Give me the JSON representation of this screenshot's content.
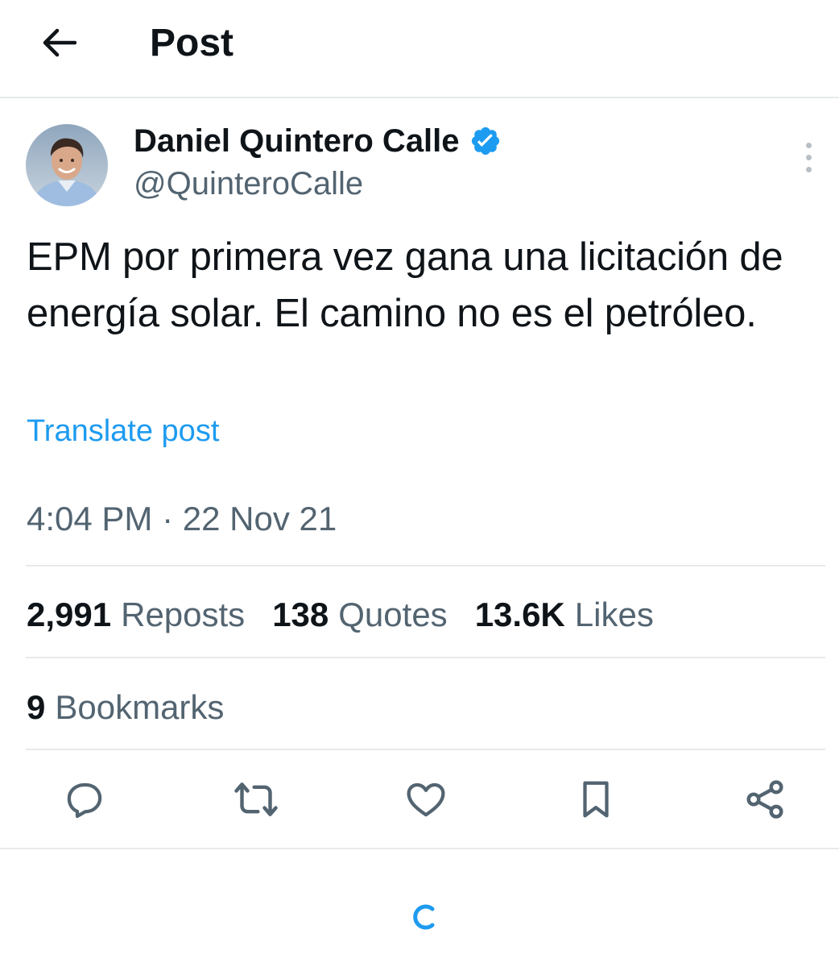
{
  "header": {
    "title": "Post",
    "back_icon": "arrow-left-icon"
  },
  "author": {
    "name": "Daniel Quintero Calle",
    "handle": "@QuinteroCalle",
    "verified": true,
    "verified_color": "#1d9bf0"
  },
  "post": {
    "text": "EPM por primera vez gana una licitación de energía solar. El camino no es el petróleo.",
    "translate_label": "Translate post",
    "timestamp": "4:04 PM · 22 Nov 21"
  },
  "stats": {
    "reposts_count": "2,991",
    "reposts_label": "Reposts",
    "quotes_count": "138",
    "quotes_label": "Quotes",
    "likes_count": "13.6K",
    "likes_label": "Likes",
    "bookmarks_count": "9",
    "bookmarks_label": "Bookmarks"
  },
  "actions": [
    "reply-icon",
    "repost-icon",
    "like-icon",
    "bookmark-icon",
    "share-icon"
  ],
  "colors": {
    "accent": "#1d9bf0",
    "text": "#0f1419",
    "secondary": "#536471",
    "divider": "#e7e9eb"
  }
}
